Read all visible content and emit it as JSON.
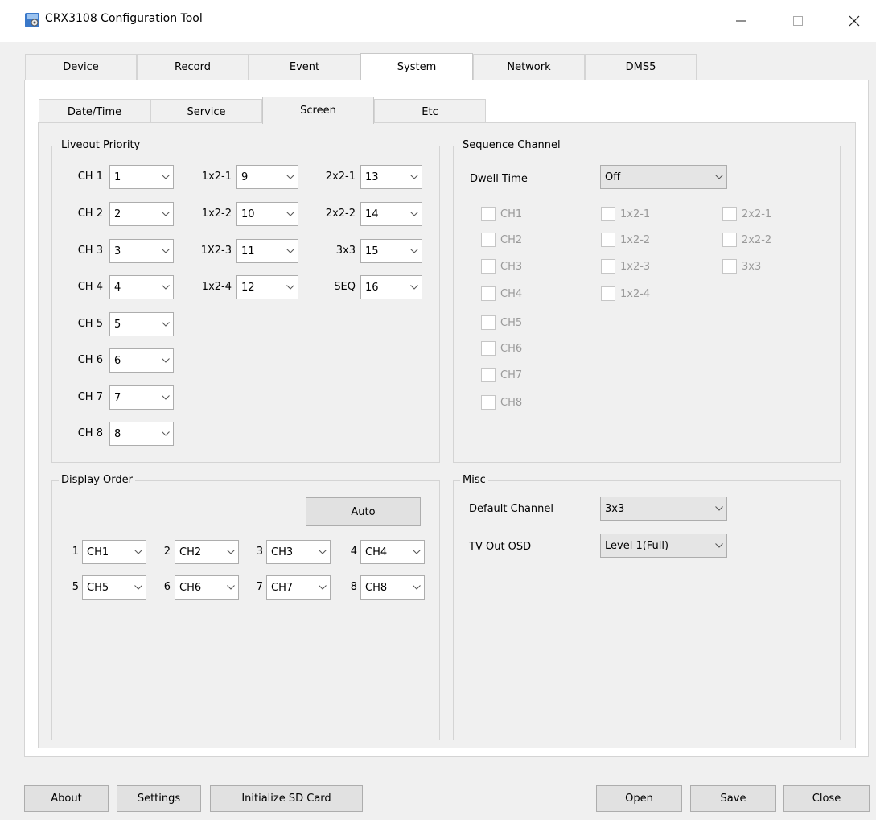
{
  "window": {
    "title": "CRX3108 Configuration Tool"
  },
  "main_tabs": [
    "Device",
    "Record",
    "Event",
    "System",
    "Network",
    "DMS5"
  ],
  "sub_tabs": [
    "Date/Time",
    "Service",
    "Screen",
    "Etc"
  ],
  "liveout": {
    "title": "Liveout Priority",
    "col1": [
      {
        "label": "CH 1",
        "value": "1"
      },
      {
        "label": "CH 2",
        "value": "2"
      },
      {
        "label": "CH 3",
        "value": "3"
      },
      {
        "label": "CH 4",
        "value": "4"
      },
      {
        "label": "CH 5",
        "value": "5"
      },
      {
        "label": "CH 6",
        "value": "6"
      },
      {
        "label": "CH 7",
        "value": "7"
      },
      {
        "label": "CH 8",
        "value": "8"
      }
    ],
    "col2": [
      {
        "label": "1x2-1",
        "value": "9"
      },
      {
        "label": "1x2-2",
        "value": "10"
      },
      {
        "label": "1X2-3",
        "value": "11"
      },
      {
        "label": "1x2-4",
        "value": "12"
      }
    ],
    "col3": [
      {
        "label": "2x2-1",
        "value": "13"
      },
      {
        "label": "2x2-2",
        "value": "14"
      },
      {
        "label": "3x3",
        "value": "15"
      },
      {
        "label": "SEQ",
        "value": "16"
      }
    ]
  },
  "sequence": {
    "title": "Sequence Channel",
    "dwell_label": "Dwell Time",
    "dwell_value": "Off",
    "col1": [
      "CH1",
      "CH2",
      "CH3",
      "CH4",
      "CH5",
      "CH6",
      "CH7",
      "CH8"
    ],
    "col2": [
      "1x2-1",
      "1x2-2",
      "1x2-3",
      "1x2-4"
    ],
    "col3": [
      "2x2-1",
      "2x2-2",
      "3x3"
    ]
  },
  "display_order": {
    "title": "Display Order",
    "auto_label": "Auto",
    "items": [
      {
        "num": "1",
        "value": "CH1"
      },
      {
        "num": "2",
        "value": "CH2"
      },
      {
        "num": "3",
        "value": "CH3"
      },
      {
        "num": "4",
        "value": "CH4"
      },
      {
        "num": "5",
        "value": "CH5"
      },
      {
        "num": "6",
        "value": "CH6"
      },
      {
        "num": "7",
        "value": "CH7"
      },
      {
        "num": "8",
        "value": "CH8"
      }
    ]
  },
  "misc": {
    "title": "Misc",
    "default_channel_label": "Default Channel",
    "default_channel_value": "3x3",
    "tv_out_label": "TV Out OSD",
    "tv_out_value": "Level 1(Full)"
  },
  "buttons": {
    "about": "About",
    "settings": "Settings",
    "init_sd": "Initialize SD Card",
    "open": "Open",
    "save": "Save",
    "close": "Close"
  },
  "icons": {
    "minimize": "minimize-icon",
    "maximize": "maximize-icon",
    "close": "close-icon",
    "dropdown": "chevron-down-icon"
  }
}
